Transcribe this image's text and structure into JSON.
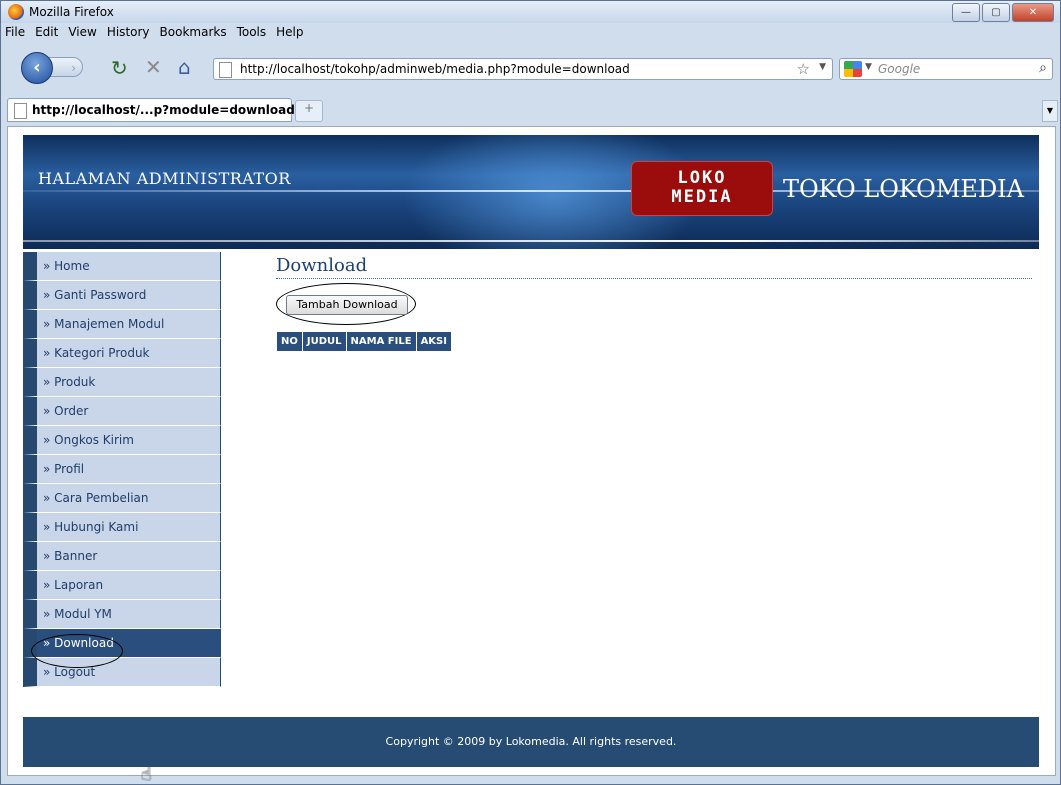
{
  "window": {
    "title": "Mozilla Firefox",
    "controls": {
      "minimize": "—",
      "maximize": "▢",
      "close": "✕"
    }
  },
  "menubar": [
    "File",
    "Edit",
    "View",
    "History",
    "Bookmarks",
    "Tools",
    "Help"
  ],
  "navbar": {
    "back": "‹",
    "forward": "›",
    "url": "http://localhost/tokohp/adminweb/media.php?module=download",
    "search_placeholder": "Google"
  },
  "tab": {
    "label": "http://localhost/...p?module=download",
    "new_tab": "+"
  },
  "banner": {
    "admin_title": "HALAMAN ADMINISTRATOR",
    "logo_text_top": "LOKO",
    "logo_text_bottom": "MEDIA",
    "site_name": "TOKO LOKOMEDIA"
  },
  "sidebar": {
    "items": [
      {
        "label": "» Home"
      },
      {
        "label": "» Ganti Password"
      },
      {
        "label": "» Manajemen Modul"
      },
      {
        "label": "» Kategori Produk"
      },
      {
        "label": "» Produk"
      },
      {
        "label": "» Order"
      },
      {
        "label": "» Ongkos Kirim"
      },
      {
        "label": "» Profil"
      },
      {
        "label": "» Cara Pembelian"
      },
      {
        "label": "» Hubungi Kami"
      },
      {
        "label": "» Banner"
      },
      {
        "label": "» Laporan"
      },
      {
        "label": "» Modul YM"
      },
      {
        "label": "» Download"
      },
      {
        "label": "» Logout"
      }
    ],
    "active": "» Download"
  },
  "main": {
    "heading": "Download",
    "add_button": "Tambah Download",
    "table_headers": [
      "NO",
      "JUDUL",
      "NAMA FILE",
      "AKSI"
    ]
  },
  "footer": {
    "copyright": "Copyright © 2009 by Lokomedia. All rights reserved."
  },
  "colors": {
    "accent": "#264c74",
    "sidebar_bg": "#c9d5e8",
    "active_bg": "#2a4f7e",
    "logo_red": "#9b0d0d"
  }
}
